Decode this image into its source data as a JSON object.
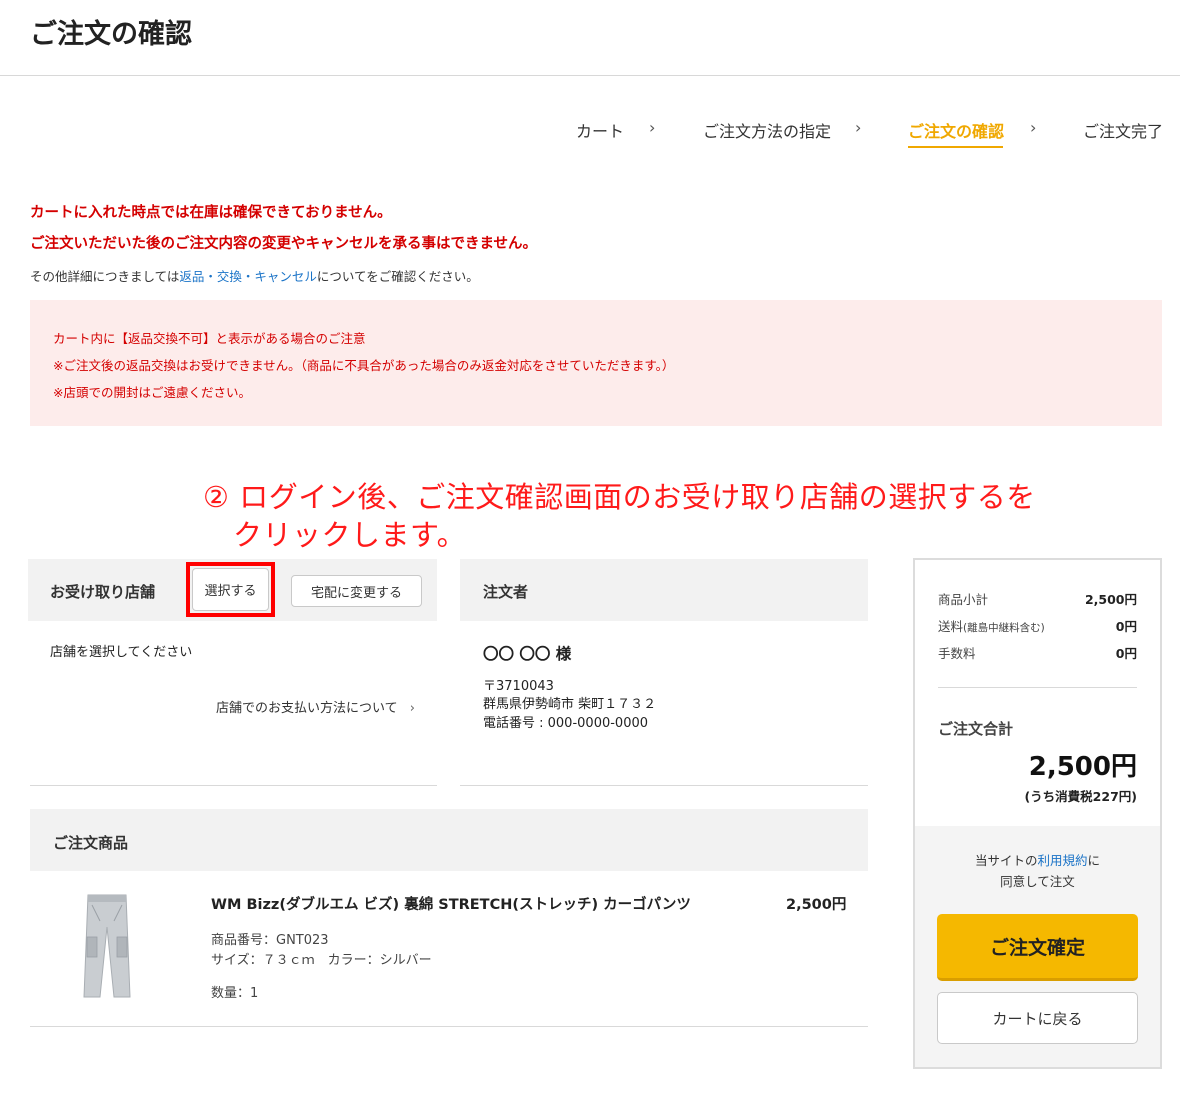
{
  "page": {
    "title": "ご注文の確認"
  },
  "steps": [
    {
      "label": "カート"
    },
    {
      "label": "ご注文方法の指定"
    },
    {
      "label": "ご注文の確認",
      "active": true
    },
    {
      "label": "ご注文完了"
    }
  ],
  "step_chevron": "›",
  "warnings": {
    "line1": "カートに入れた時点では在庫は確保できておりません。",
    "line2": "ご注文いただいた後のご注文内容の変更やキャンセルを承る事はできません。",
    "details_prefix": "その他詳細につきましては",
    "details_link": "返品・交換・キャンセル",
    "details_suffix": "についてをご確認ください。"
  },
  "notice": {
    "title": "カート内に【返品交換不可】と表示がある場合のご注意",
    "line1": "※ご注文後の返品交換はお受けできません。（商品に不具合があった場合のみ返金対応をさせていただきます。）",
    "line2": "※店頭での開封はご遠慮ください。"
  },
  "annotation": {
    "line1": "② ログイン後、ご注文確認画面のお受け取り店舗の選択するを",
    "line2": "クリックします。"
  },
  "pickup": {
    "title": "お受け取り店舗",
    "select_button": "選択する",
    "delivery_button": "宅配に変更する",
    "placeholder": "店舗を選択してください",
    "payment_link": "店舗でのお支払い方法について",
    "payment_chevron": "›"
  },
  "orderer": {
    "title": "注文者",
    "name": "〇〇 〇〇 様",
    "postal": "〒3710043",
    "address": "群馬県伊勢崎市 柴町１７３２",
    "phone": "電話番号 : 000-0000-0000"
  },
  "products": {
    "title": "ご注文商品",
    "items": [
      {
        "name": "WM Bizz(ダブルエム ビズ) 裏綿 STRETCH(ストレッチ) カーゴパンツ",
        "price": "2,500円",
        "code": "商品番号：GNT023",
        "size_color": "サイズ：７３ｃｍ　カラー：シルバー",
        "qty": "数量：1",
        "image_icon": "cargo-pants-image"
      }
    ]
  },
  "summary": {
    "subtotal_label": "商品小計",
    "subtotal_value": "2,500円",
    "shipping_label": "送料",
    "shipping_note": "(離島中継料含む)",
    "shipping_value": "0円",
    "fee_label": "手数料",
    "fee_value": "0円",
    "total_label": "ご注文合計",
    "total_value": "2,500円",
    "tax_note": "(うち消費税227円)",
    "agree_prefix": "当サイトの",
    "agree_link": "利用規約",
    "agree_suffix": "に",
    "agree_line2": "同意して注文",
    "confirm_button": "ご注文確定",
    "back_button": "カートに戻る"
  },
  "colors": {
    "accent": "#f0a800",
    "warning": "#d40000",
    "link": "#1a73c7",
    "annotation": "#ff1a1a"
  }
}
